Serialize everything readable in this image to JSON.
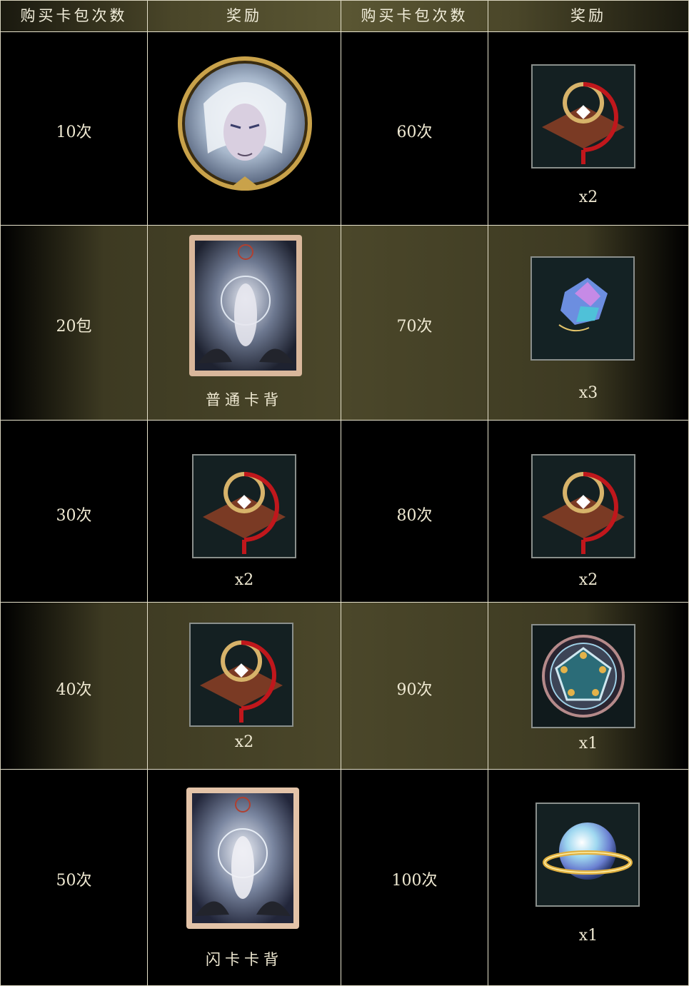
{
  "headers": [
    "购买卡包次数",
    "奖励",
    "购买卡包次数",
    "奖励"
  ],
  "rows": [
    {
      "left_count": "10次",
      "left_reward_icon": "silver-hair-character-avatar-icon",
      "left_reward_label": "",
      "right_count": "60次",
      "right_reward_icon": "red-gold-knot-emblem-icon",
      "right_reward_label": "x2"
    },
    {
      "left_count": "20包",
      "left_reward_icon": "card-back-art-icon",
      "left_reward_label": "普通卡背",
      "right_count": "70次",
      "right_reward_icon": "crystal-shard-icon",
      "right_reward_label": "x3"
    },
    {
      "left_count": "30次",
      "left_reward_icon": "red-gold-knot-emblem-icon",
      "left_reward_label": "x2",
      "right_count": "80次",
      "right_reward_icon": "red-gold-knot-emblem-icon",
      "right_reward_label": "x2"
    },
    {
      "left_count": "40次",
      "left_reward_icon": "red-gold-knot-emblem-icon",
      "left_reward_label": "x2",
      "right_count": "90次",
      "right_reward_icon": "pentagon-rune-disc-icon",
      "right_reward_label": "x1"
    },
    {
      "left_count": "50次",
      "left_reward_icon": "card-back-art-icon",
      "left_reward_label": "闪卡卡背",
      "right_count": "100次",
      "right_reward_icon": "crystal-orb-ring-icon",
      "right_reward_label": "x1"
    }
  ],
  "colors": {
    "text": "#efe9d2",
    "olive_band": "#4b472a",
    "border": "#e6e2cc"
  }
}
